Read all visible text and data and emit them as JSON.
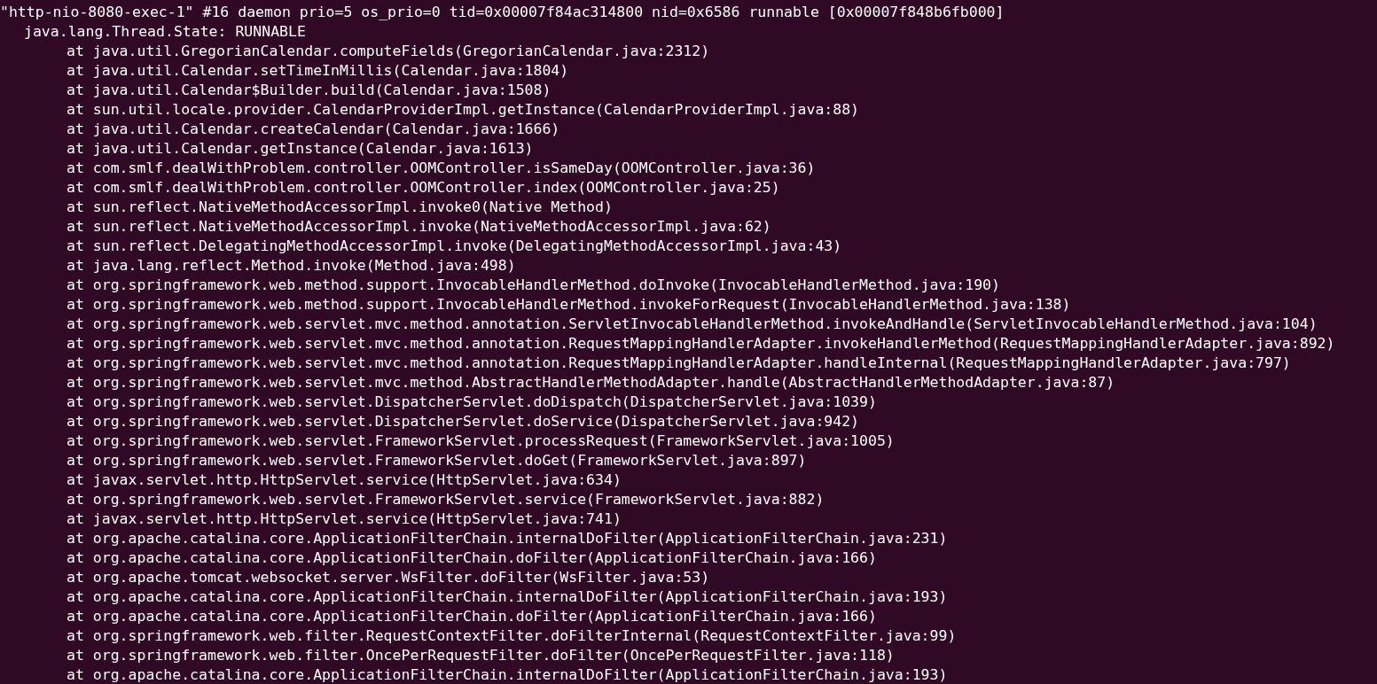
{
  "terminal": {
    "lines": [
      {
        "kind": "header",
        "text": "\"http-nio-8080-exec-1\" #16 daemon prio=5 os_prio=0 tid=0x00007f84ac314800 nid=0x6586 runnable [0x00007f848b6fb000]"
      },
      {
        "kind": "state",
        "text": "java.lang.Thread.State: RUNNABLE"
      },
      {
        "kind": "frame",
        "text": "at java.util.GregorianCalendar.computeFields(GregorianCalendar.java:2312)"
      },
      {
        "kind": "frame",
        "text": "at java.util.Calendar.setTimeInMillis(Calendar.java:1804)"
      },
      {
        "kind": "frame",
        "text": "at java.util.Calendar$Builder.build(Calendar.java:1508)"
      },
      {
        "kind": "frame",
        "text": "at sun.util.locale.provider.CalendarProviderImpl.getInstance(CalendarProviderImpl.java:88)"
      },
      {
        "kind": "frame",
        "text": "at java.util.Calendar.createCalendar(Calendar.java:1666)"
      },
      {
        "kind": "frame",
        "text": "at java.util.Calendar.getInstance(Calendar.java:1613)"
      },
      {
        "kind": "frame",
        "text": "at com.smlf.dealWithProblem.controller.OOMController.isSameDay(OOMController.java:36)"
      },
      {
        "kind": "frame",
        "text": "at com.smlf.dealWithProblem.controller.OOMController.index(OOMController.java:25)"
      },
      {
        "kind": "frame",
        "text": "at sun.reflect.NativeMethodAccessorImpl.invoke0(Native Method)"
      },
      {
        "kind": "frame",
        "text": "at sun.reflect.NativeMethodAccessorImpl.invoke(NativeMethodAccessorImpl.java:62)"
      },
      {
        "kind": "frame",
        "text": "at sun.reflect.DelegatingMethodAccessorImpl.invoke(DelegatingMethodAccessorImpl.java:43)"
      },
      {
        "kind": "frame",
        "text": "at java.lang.reflect.Method.invoke(Method.java:498)"
      },
      {
        "kind": "frame",
        "text": "at org.springframework.web.method.support.InvocableHandlerMethod.doInvoke(InvocableHandlerMethod.java:190)"
      },
      {
        "kind": "frame",
        "text": "at org.springframework.web.method.support.InvocableHandlerMethod.invokeForRequest(InvocableHandlerMethod.java:138)"
      },
      {
        "kind": "frame",
        "text": "at org.springframework.web.servlet.mvc.method.annotation.ServletInvocableHandlerMethod.invokeAndHandle(ServletInvocableHandlerMethod.java:104)"
      },
      {
        "kind": "frame",
        "text": "at org.springframework.web.servlet.mvc.method.annotation.RequestMappingHandlerAdapter.invokeHandlerMethod(RequestMappingHandlerAdapter.java:892)"
      },
      {
        "kind": "frame",
        "text": "at org.springframework.web.servlet.mvc.method.annotation.RequestMappingHandlerAdapter.handleInternal(RequestMappingHandlerAdapter.java:797)"
      },
      {
        "kind": "frame",
        "text": "at org.springframework.web.servlet.mvc.method.AbstractHandlerMethodAdapter.handle(AbstractHandlerMethodAdapter.java:87)"
      },
      {
        "kind": "frame",
        "text": "at org.springframework.web.servlet.DispatcherServlet.doDispatch(DispatcherServlet.java:1039)"
      },
      {
        "kind": "frame",
        "text": "at org.springframework.web.servlet.DispatcherServlet.doService(DispatcherServlet.java:942)"
      },
      {
        "kind": "frame",
        "text": "at org.springframework.web.servlet.FrameworkServlet.processRequest(FrameworkServlet.java:1005)"
      },
      {
        "kind": "frame",
        "text": "at org.springframework.web.servlet.FrameworkServlet.doGet(FrameworkServlet.java:897)"
      },
      {
        "kind": "frame",
        "text": "at javax.servlet.http.HttpServlet.service(HttpServlet.java:634)"
      },
      {
        "kind": "frame",
        "text": "at org.springframework.web.servlet.FrameworkServlet.service(FrameworkServlet.java:882)"
      },
      {
        "kind": "frame",
        "text": "at javax.servlet.http.HttpServlet.service(HttpServlet.java:741)"
      },
      {
        "kind": "frame",
        "text": "at org.apache.catalina.core.ApplicationFilterChain.internalDoFilter(ApplicationFilterChain.java:231)"
      },
      {
        "kind": "frame",
        "text": "at org.apache.catalina.core.ApplicationFilterChain.doFilter(ApplicationFilterChain.java:166)"
      },
      {
        "kind": "frame",
        "text": "at org.apache.tomcat.websocket.server.WsFilter.doFilter(WsFilter.java:53)"
      },
      {
        "kind": "frame",
        "text": "at org.apache.catalina.core.ApplicationFilterChain.internalDoFilter(ApplicationFilterChain.java:193)"
      },
      {
        "kind": "frame",
        "text": "at org.apache.catalina.core.ApplicationFilterChain.doFilter(ApplicationFilterChain.java:166)"
      },
      {
        "kind": "frame",
        "text": "at org.springframework.web.filter.RequestContextFilter.doFilterInternal(RequestContextFilter.java:99)"
      },
      {
        "kind": "frame",
        "text": "at org.springframework.web.filter.OncePerRequestFilter.doFilter(OncePerRequestFilter.java:118)"
      },
      {
        "kind": "frame",
        "text": "at org.apache.catalina.core.ApplicationFilterChain.internalDoFilter(ApplicationFilterChain.java:193)"
      }
    ]
  }
}
